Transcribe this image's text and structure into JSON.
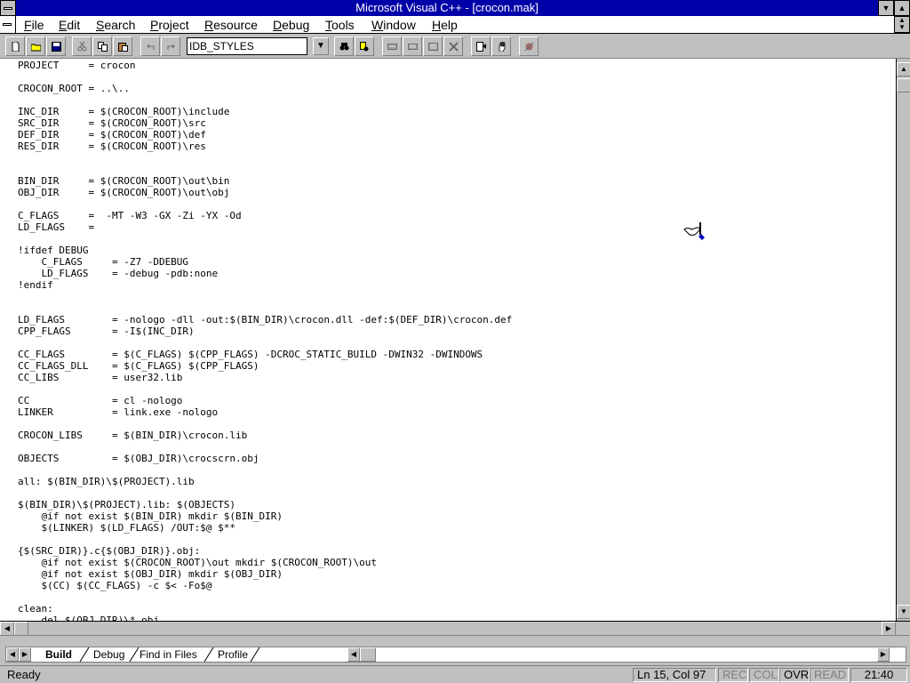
{
  "window": {
    "title": "Microsoft Visual C++ - [crocon.mak]"
  },
  "menu": [
    {
      "label": "File",
      "key": "F",
      "rest": "ile"
    },
    {
      "label": "Edit",
      "key": "E",
      "rest": "dit"
    },
    {
      "label": "Search",
      "key": "S",
      "rest": "earch"
    },
    {
      "label": "Project",
      "key": "P",
      "rest": "roject"
    },
    {
      "label": "Resource",
      "key": "R",
      "rest": "esource"
    },
    {
      "label": "Debug",
      "key": "D",
      "rest": "ebug"
    },
    {
      "label": "Tools",
      "key": "T",
      "rest": "ools"
    },
    {
      "label": "Window",
      "key": "W",
      "rest": "indow"
    },
    {
      "label": "Help",
      "key": "H",
      "rest": "elp"
    }
  ],
  "toolbar": {
    "combo_value": "IDB_STYLES",
    "buttons": [
      {
        "name": "new-file",
        "icon": "new-file-icon"
      },
      {
        "name": "open-file",
        "icon": "open-folder-icon"
      },
      {
        "name": "save-file",
        "icon": "save-disk-icon"
      },
      {
        "name": "cut",
        "icon": "scissors-icon"
      },
      {
        "name": "copy",
        "icon": "copy-icon"
      },
      {
        "name": "paste",
        "icon": "paste-icon"
      },
      {
        "name": "undo",
        "icon": "undo-icon"
      },
      {
        "name": "redo",
        "icon": "redo-icon"
      },
      {
        "name": "find",
        "icon": "find-binoculars-icon"
      },
      {
        "name": "find-in-files",
        "icon": "find-in-files-icon"
      },
      {
        "name": "compile",
        "icon": "compile-icon"
      },
      {
        "name": "build",
        "icon": "build-icon"
      },
      {
        "name": "rebuild-all",
        "icon": "rebuild-icon"
      },
      {
        "name": "stop-build",
        "icon": "stop-build-icon"
      },
      {
        "name": "run",
        "icon": "run-icon"
      },
      {
        "name": "go",
        "icon": "hand-icon"
      },
      {
        "name": "breakpoint",
        "icon": "breakpoint-icon"
      }
    ]
  },
  "editor": {
    "lines": [
      "PROJECT     = crocon",
      "",
      "CROCON_ROOT = ..\\..",
      "",
      "INC_DIR     = $(CROCON_ROOT)\\include",
      "SRC_DIR     = $(CROCON_ROOT)\\src",
      "DEF_DIR     = $(CROCON_ROOT)\\def",
      "RES_DIR     = $(CROCON_ROOT)\\res",
      "",
      "",
      "BIN_DIR     = $(CROCON_ROOT)\\out\\bin",
      "OBJ_DIR     = $(CROCON_ROOT)\\out\\obj",
      "",
      "C_FLAGS     =  -MT -W3 -GX -Zi -YX -Od",
      "LD_FLAGS    =",
      "",
      "!ifdef DEBUG",
      "    C_FLAGS     = -Z7 -DDEBUG",
      "    LD_FLAGS    = -debug -pdb:none",
      "!endif",
      "",
      "",
      "LD_FLAGS        = -nologo -dll -out:$(BIN_DIR)\\crocon.dll -def:$(DEF_DIR)\\crocon.def",
      "CPP_FLAGS       = -I$(INC_DIR)",
      "",
      "CC_FLAGS        = $(C_FLAGS) $(CPP_FLAGS) -DCROC_STATIC_BUILD -DWIN32 -DWINDOWS",
      "CC_FLAGS_DLL    = $(C_FLAGS) $(CPP_FLAGS)",
      "CC_LIBS         = user32.lib",
      "",
      "CC              = cl -nologo",
      "LINKER          = link.exe -nologo",
      "",
      "CROCON_LIBS     = $(BIN_DIR)\\crocon.lib",
      "",
      "OBJECTS         = $(OBJ_DIR)\\crocscrn.obj",
      "",
      "all: $(BIN_DIR)\\$(PROJECT).lib",
      "",
      "$(BIN_DIR)\\$(PROJECT).lib: $(OBJECTS)",
      "    @if not exist $(BIN_DIR) mkdir $(BIN_DIR)",
      "    $(LINKER) $(LD_FLAGS) /OUT:$@ $**",
      "",
      "{$(SRC_DIR)}.c{$(OBJ_DIR)}.obj:",
      "    @if not exist $(CROCON_ROOT)\\out mkdir $(CROCON_ROOT)\\out",
      "    @if not exist $(OBJ_DIR) mkdir $(OBJ_DIR)",
      "    $(CC) $(CC_FLAGS) -c $< -Fo$@",
      "",
      "clean:",
      "    del $(OBJ_DIR)\\*.obj"
    ]
  },
  "tabs": [
    {
      "label": "Build",
      "active": true
    },
    {
      "label": "Debug",
      "active": false
    },
    {
      "label": "Find in Files",
      "active": false
    },
    {
      "label": "Profile",
      "active": false
    }
  ],
  "status": {
    "text": "Ready",
    "position": "Ln 15, Col 97",
    "rec": "REC",
    "col": "COL",
    "ovr": "OVR",
    "read": "READ",
    "time": "21:40"
  },
  "colors": {
    "title_bar": "#0000a8",
    "face": "#c0c0c0",
    "editor_bg": "#ffffff"
  }
}
